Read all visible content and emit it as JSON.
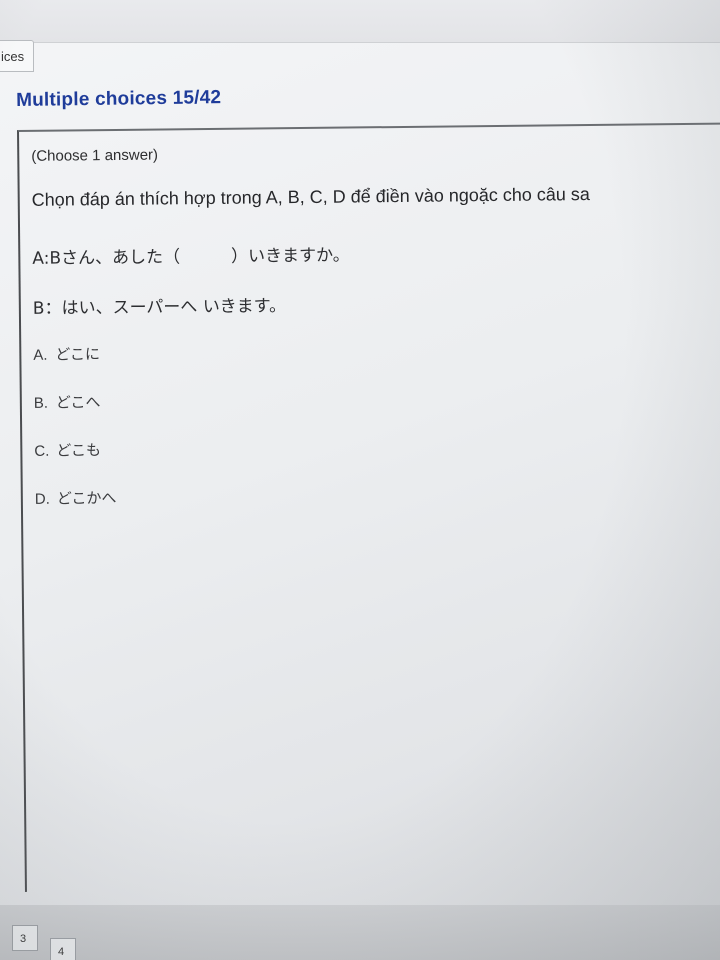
{
  "tab": {
    "label": "ices"
  },
  "header": {
    "title": "Multiple choices 15/42"
  },
  "question": {
    "instruction": "(Choose 1 answer)",
    "prompt": "Chọn đáp án thích hợp trong A, B, C, D để điền vào ngoặc cho câu sa",
    "line_a": "A:Bさん、あした（　　　）いきますか。",
    "line_b": "B：はい、スーパーへ  いきます。"
  },
  "options": [
    {
      "letter": "A.",
      "text": "どこに"
    },
    {
      "letter": "B.",
      "text": "どこへ"
    },
    {
      "letter": "C.",
      "text": "どこも"
    },
    {
      "letter": "D.",
      "text": "どこかへ"
    }
  ],
  "pagination": {
    "p3": "3",
    "p4": "4"
  }
}
